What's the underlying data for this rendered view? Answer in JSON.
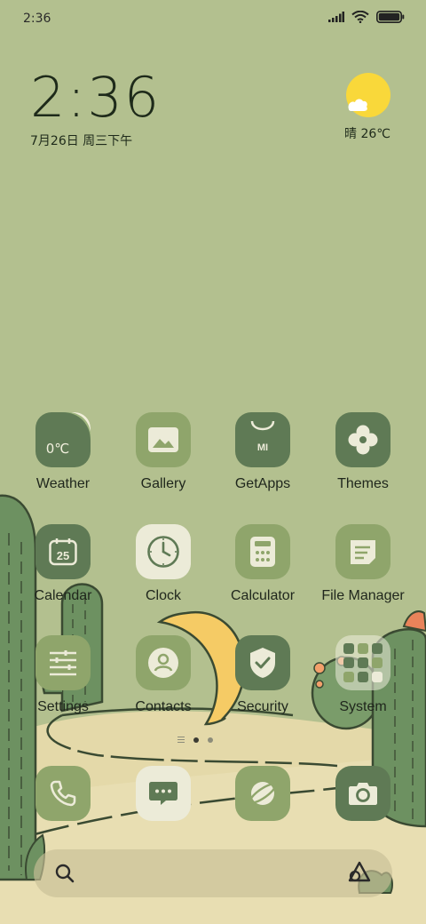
{
  "status_bar": {
    "time": "2:36",
    "battery_level": 1.0
  },
  "clock_widget": {
    "time": "2:36",
    "date": "7月26日 周三下午"
  },
  "weather_widget": {
    "text": "晴 26℃",
    "icon": "sun-cloud-icon"
  },
  "apps": [
    {
      "label": "Weather",
      "icon": "weather-icon",
      "icon_text": "0℃"
    },
    {
      "label": "Gallery",
      "icon": "gallery-icon"
    },
    {
      "label": "GetApps",
      "icon": "getapps-icon",
      "icon_text": "MI"
    },
    {
      "label": "Themes",
      "icon": "themes-icon"
    },
    {
      "label": "Calendar",
      "icon": "calendar-icon",
      "icon_text": "25"
    },
    {
      "label": "Clock",
      "icon": "clock-icon"
    },
    {
      "label": "Calculator",
      "icon": "calculator-icon"
    },
    {
      "label": "File Manager",
      "icon": "file-manager-icon"
    },
    {
      "label": "Settings",
      "icon": "settings-icon"
    },
    {
      "label": "Contacts",
      "icon": "contacts-icon"
    },
    {
      "label": "Security",
      "icon": "security-icon"
    },
    {
      "label": "System",
      "icon": "folder-icon"
    }
  ],
  "pager": {
    "pages": 2,
    "current": 1
  },
  "dock": [
    {
      "name": "phone",
      "icon": "phone-icon"
    },
    {
      "name": "messages",
      "icon": "messages-icon"
    },
    {
      "name": "browser",
      "icon": "browser-icon"
    },
    {
      "name": "camera",
      "icon": "camera-icon"
    }
  ],
  "search_bar": {
    "icon": "search-icon",
    "assistant_icon": "assistant-icon"
  },
  "colors": {
    "background": "#b3c08f",
    "dark_green": "#5f7a55",
    "mid_green": "#8fa56b",
    "cream": "#ecebd8",
    "sand": "#e3d7a8",
    "cactus": "#6d9161",
    "moon": "#f5cb65",
    "sun": "#f9d83a"
  }
}
